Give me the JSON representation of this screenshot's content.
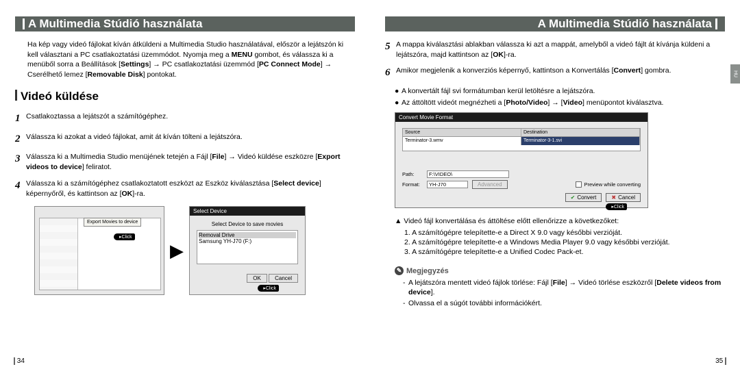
{
  "header": {
    "title": "A Multimedia Stúdió használata"
  },
  "side_tab": "HU",
  "left": {
    "intro_parts": [
      "Ha kép vagy videó fájlokat kíván átküldeni a Multimedia Studio használatával, először a lejátszón ki kell választani a PC csatlakoztatási üzemmódot. Nyomja meg a ",
      "MENU",
      " gombot, és válassza ki a menüből sorra a Beállítások [",
      "Settings",
      "] → PC csatlakoztatási üzemmód [",
      "PC Connect Mode",
      "] → Cserélhető lemez [",
      "Removable Disk",
      "] pontokat."
    ],
    "section_title": "Videó küldése",
    "steps": [
      {
        "num": "1",
        "text": "Csatlakoztassa a lejátszót a számítógéphez."
      },
      {
        "num": "2",
        "text": "Válassza ki azokat a videó fájlokat, amit át kíván tölteni a lejátszóra."
      },
      {
        "num": "3",
        "parts": [
          "Válassza ki a Multimedia Studio menüjének tetején a Fájl [",
          "File",
          "] → Videó küldése eszközre [",
          "Export videos to device",
          "] feliratot."
        ]
      },
      {
        "num": "4",
        "parts": [
          "Válassza ki a számítógéphez csatlakoztatott eszközt az Eszköz kiválasztása [",
          "Select device",
          "] képernyőről, és kattintson az [",
          "OK",
          "]-ra."
        ]
      }
    ],
    "shot1": {
      "tooltip": "Export Movies to device",
      "click": "Click"
    },
    "shot2": {
      "title": "Select Device",
      "label": "Select Device to save movies",
      "list": [
        "Removal Drive",
        "Samsung YH-J70 (F:)"
      ],
      "ok": "OK",
      "cancel": "Cancel",
      "click": "Click"
    },
    "page_number": "34"
  },
  "right": {
    "steps": [
      {
        "num": "5",
        "parts": [
          "A mappa kiválasztási ablakban válassza ki azt a mappát, amelyből a videó fájlt át kívánja küldeni a lejátszóra, majd kattintson az [",
          "OK",
          "]-ra."
        ]
      },
      {
        "num": "6",
        "parts": [
          "Amikor megjelenik a konverziós képernyő, kattintson a Konvertálás [",
          "Convert",
          "] gombra."
        ]
      }
    ],
    "bullets": [
      "A konvertált fájl svi formátumban kerül letöltésre a lejátszóra.",
      {
        "parts": [
          "Az áttöltött videót megnézheti a [",
          "Photo/Video",
          "] → [",
          "Video",
          "] menüpontot kiválasztva."
        ]
      }
    ],
    "shot3": {
      "title": "Convert Movie Format",
      "col_source": "Source",
      "col_dest": "Destination",
      "row_source": "Terminator-3.wmv",
      "row_dest": "Terminator-3-1.svi",
      "path_label": "Path:",
      "path_value": "F:\\VIDEO\\",
      "format_label": "Format:",
      "format_value": "YH-J70",
      "advanced": "Advanced",
      "preview_check": "Preview while converting",
      "convert_btn": "Convert",
      "cancel_btn": "Cancel",
      "click": "Click"
    },
    "check": {
      "title": "▲ Videó fájl konvertálása és áttöltése előtt ellenőrizze a következőket:",
      "lines": [
        "1. A számítógépre telepítette-e a Direct X 9.0 vagy későbbi verzióját.",
        "2. A számítógépre telepítette-e a Windows Media Player 9.0 vagy későbbi verzióját.",
        "3. A számítógépre telepítette-e a Unified Codec Pack-et."
      ]
    },
    "note": {
      "title": "Megjegyzés",
      "lines": [
        {
          "parts": [
            "A lejátszóra mentett videó fájlok törlése: Fájl [",
            "File",
            "] → Videó törlése eszközről [",
            "Delete videos from device",
            "]."
          ]
        },
        {
          "text": "Olvassa el a súgót további információkért."
        }
      ]
    },
    "page_number": "35"
  }
}
